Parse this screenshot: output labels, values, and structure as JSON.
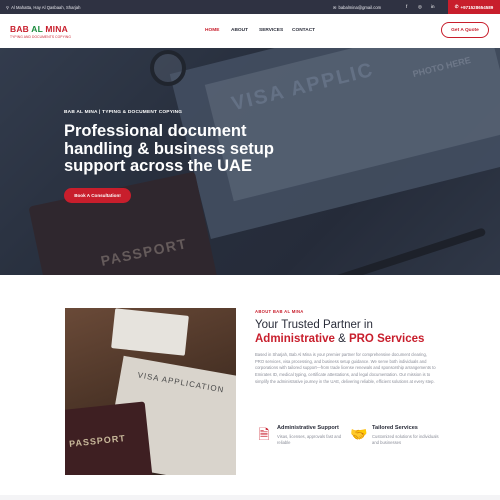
{
  "topbar": {
    "location": "Al Mahatta, Hay Al Qasbaah, Sharjah",
    "email": "babalmina@gmail.com",
    "phone": "+971528654589",
    "social": [
      "f",
      "◎",
      "in"
    ]
  },
  "brand": {
    "name_part1": "BAB ",
    "name_part2": "AL",
    "name_part3": " MINA",
    "tagline": "TYPING AND DOCUMENTS COPYING"
  },
  "nav": {
    "items": [
      "HOME",
      "ABOUT",
      "SERVICES",
      "CONTACT"
    ],
    "active": "HOME",
    "quote_label": "Get A Quote"
  },
  "hero": {
    "eyebrow": "BAB AL MINA | TYPING & DOCUMENT COPYING",
    "headline": "Professional document handling & business setup support across the UAE",
    "cta_label": "Book A Consultation!",
    "bg_text_visa": "VISA APPLIC",
    "bg_text_photo": "PHOTO HERE",
    "bg_text_passport": "PASSPORT"
  },
  "about": {
    "eyebrow": "ABOUT BAB AL MINA",
    "heading_line1": "Your Trusted Partner in",
    "heading_red1": "Administrative",
    "heading_amp": " & ",
    "heading_red2": "PRO Services",
    "paragraph": "Based in Sharjah, Bab Al Mina is your premier partner for comprehensive document clearing, PRO services, visa processing, and business setup guidance. We serve both individuals and corporations with tailored support—from trade license renewals and sponsorship arrangements to Emirates ID, medical typing, certificate attestations, and legal documentation. Our mission is to simplify the administrative journey in the UAE, delivering reliable, efficient solutions at every step.",
    "image_text_visa": "VISA APPLICATION",
    "image_text_passport": "PASSPORT",
    "features": [
      {
        "title": "Administrative Support",
        "desc": "Visas, licenses, approvals fast and reliable",
        "icon": "document-check-icon"
      },
      {
        "title": "Tailored Services",
        "desc": "Customized solutions for individuals and businesses",
        "icon": "handshake-icon"
      }
    ]
  },
  "colors": {
    "accent": "#c81e2c",
    "green": "#1a8a3c",
    "dark": "#2f3242"
  }
}
